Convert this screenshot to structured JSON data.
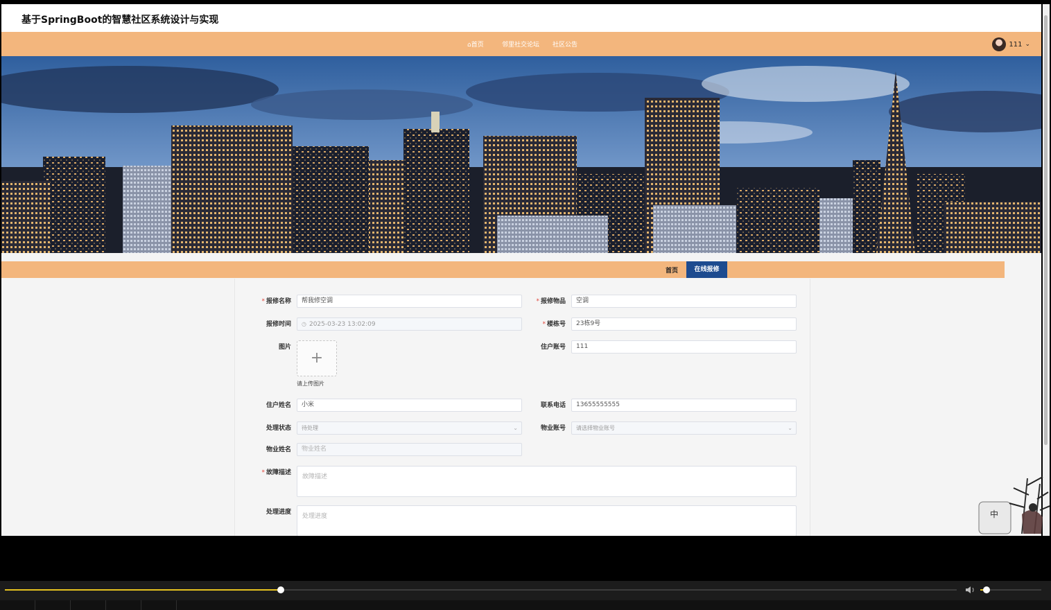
{
  "site": {
    "title": "基于SpringBoot的智慧社区系统设计与实现"
  },
  "nav": {
    "home": "首页",
    "forum": "邻里社交论坛",
    "notice": "社区公告",
    "home_icon": "home-icon"
  },
  "user": {
    "name": "111",
    "caret": "⌄"
  },
  "breadcrumb": {
    "home": "首页",
    "current": "在线报修"
  },
  "form": {
    "fields": {
      "repair_name": {
        "label": "报修名称",
        "value": "帮我修空调",
        "required": true
      },
      "repair_item": {
        "label": "报修物品",
        "value": "空调",
        "required": true
      },
      "repair_time": {
        "label": "报修时间",
        "value": "2025-03-23 13:02:09"
      },
      "building": {
        "label": "楼栋号",
        "value": "23栋9号",
        "required": true
      },
      "image": {
        "label": "图片",
        "tip": "请上传图片"
      },
      "resident_account": {
        "label": "住户账号",
        "value": "111"
      },
      "resident_name": {
        "label": "住户姓名",
        "value": "小米"
      },
      "phone": {
        "label": "联系电话",
        "value": "13655555555"
      },
      "status": {
        "label": "处理状态",
        "value": "待处理"
      },
      "property_account": {
        "label": "物业账号",
        "placeholder": "请选择物业账号"
      },
      "property_name": {
        "label": "物业姓名",
        "placeholder": "物业姓名"
      },
      "fault_desc": {
        "label": "故障描述",
        "placeholder": "故障描述",
        "required": true
      },
      "progress": {
        "label": "处理进度",
        "placeholder": "处理进度"
      }
    },
    "required_mark": "*"
  },
  "player": {
    "progress_fraction": 0.29,
    "volume_fraction": 0.1
  },
  "colors": {
    "accent": "#f3b67d",
    "active_tab": "#1d4b8f",
    "seek": "#e6c320"
  }
}
